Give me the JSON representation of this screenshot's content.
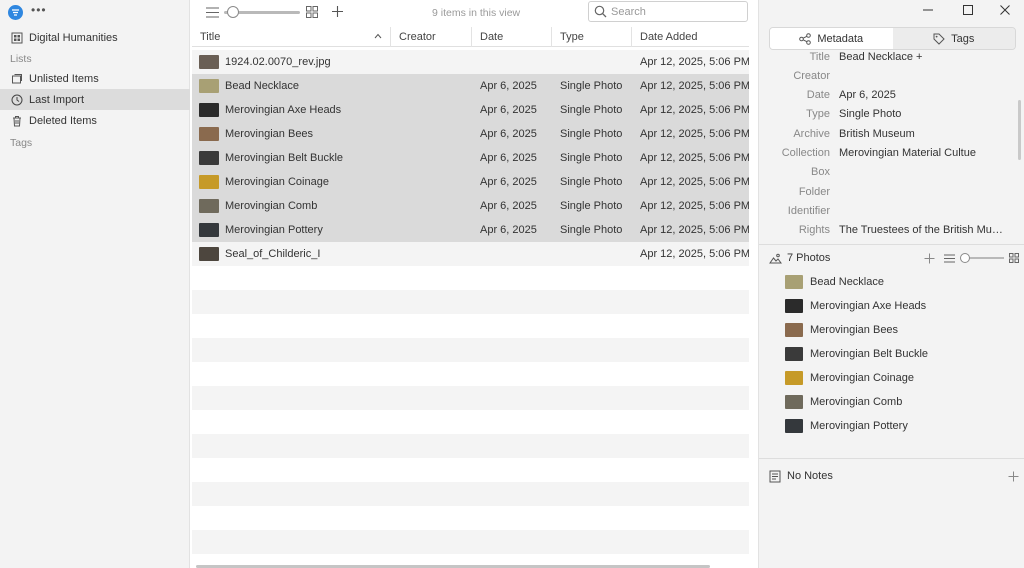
{
  "sidebar": {
    "library": "Digital Humanities",
    "lists_heading": "Lists",
    "items": [
      {
        "label": "Unlisted Items"
      },
      {
        "label": "Last Import"
      },
      {
        "label": "Deleted Items"
      }
    ],
    "tags_heading": "Tags"
  },
  "toolbar": {
    "items_count": "9 items in this view",
    "search_placeholder": "Search",
    "zoom_level_fraction": 0.05
  },
  "table": {
    "columns": [
      "Title",
      "Creator",
      "Date",
      "Type",
      "Date Added"
    ],
    "rows": [
      {
        "title": "1924.02.0070_rev.jpg",
        "creator": "",
        "date": "",
        "type": "",
        "added": "Apr 12, 2025, 5:06 PM",
        "thumb": "#6a5f55",
        "selected": false
      },
      {
        "title": "Bead Necklace",
        "creator": "",
        "date": "Apr 6, 2025",
        "type": "Single Photo",
        "added": "Apr 12, 2025, 5:06 PM",
        "thumb": "#a8a074",
        "selected": true
      },
      {
        "title": "Merovingian Axe Heads",
        "creator": "",
        "date": "Apr 6, 2025",
        "type": "Single Photo",
        "added": "Apr 12, 2025, 5:06 PM",
        "thumb": "#2b2b2b",
        "selected": true
      },
      {
        "title": "Merovingian Bees",
        "creator": "",
        "date": "Apr 6, 2025",
        "type": "Single Photo",
        "added": "Apr 12, 2025, 5:06 PM",
        "thumb": "#8a6a4e",
        "selected": true
      },
      {
        "title": "Merovingian Belt Buckle",
        "creator": "",
        "date": "Apr 6, 2025",
        "type": "Single Photo",
        "added": "Apr 12, 2025, 5:06 PM",
        "thumb": "#3a3a3a",
        "selected": true
      },
      {
        "title": "Merovingian Coinage",
        "creator": "",
        "date": "Apr 6, 2025",
        "type": "Single Photo",
        "added": "Apr 12, 2025, 5:06 PM",
        "thumb": "#c69a28",
        "selected": true
      },
      {
        "title": "Merovingian Comb",
        "creator": "",
        "date": "Apr 6, 2025",
        "type": "Single Photo",
        "added": "Apr 12, 2025, 5:06 PM",
        "thumb": "#6f6a5c",
        "selected": true
      },
      {
        "title": "Merovingian Pottery",
        "creator": "",
        "date": "Apr 6, 2025",
        "type": "Single Photo",
        "added": "Apr 12, 2025, 5:06 PM",
        "thumb": "#34383c",
        "selected": true
      },
      {
        "title": "Seal_of_Childeric_I",
        "creator": "",
        "date": "",
        "type": "",
        "added": "Apr 12, 2025, 5:06 PM",
        "thumb": "#4d463e",
        "selected": false
      }
    ]
  },
  "panel": {
    "tabs": [
      "Metadata",
      "Tags"
    ],
    "metadata": [
      {
        "label": "Title",
        "value": "Bead Necklace +"
      },
      {
        "label": "Creator",
        "value": ""
      },
      {
        "label": "Date",
        "value": "Apr 6, 2025"
      },
      {
        "label": "Type",
        "value": "Single Photo"
      },
      {
        "label": "Archive",
        "value": "British Museum"
      },
      {
        "label": "Collection",
        "value": "Merovingian Material Cultue"
      },
      {
        "label": "Box",
        "value": ""
      },
      {
        "label": "Folder",
        "value": ""
      },
      {
        "label": "Identifier",
        "value": ""
      },
      {
        "label": "Rights",
        "value": "The Truestees of the British Muse…"
      }
    ],
    "photos_label": "7 Photos",
    "photos": [
      {
        "label": "Bead Necklace",
        "thumb": "#a8a074"
      },
      {
        "label": "Merovingian Axe Heads",
        "thumb": "#2b2b2b"
      },
      {
        "label": "Merovingian Bees",
        "thumb": "#8a6a4e"
      },
      {
        "label": "Merovingian Belt Buckle",
        "thumb": "#3a3a3a"
      },
      {
        "label": "Merovingian Coinage",
        "thumb": "#c69a28"
      },
      {
        "label": "Merovingian Comb",
        "thumb": "#6f6a5c"
      },
      {
        "label": "Merovingian Pottery",
        "thumb": "#34383c"
      }
    ],
    "notes_label": "No Notes"
  },
  "colors": {
    "accent": "#2f87e0",
    "selected_row": "#dadada",
    "alt_row": "#f4f4f4",
    "sidebar_bg": "#f3f3f3"
  }
}
